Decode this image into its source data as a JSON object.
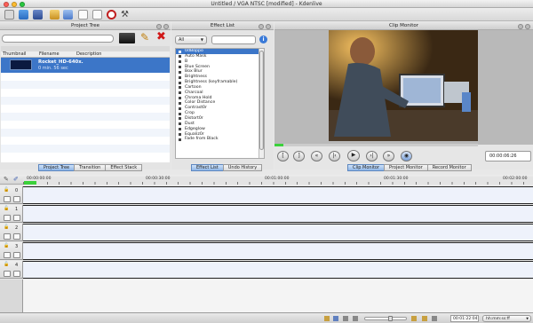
{
  "window": {
    "title": "Untitled / VGA NTSC [modified] - Kdenlive"
  },
  "project_tree": {
    "header": "Project Tree",
    "columns": [
      "Thumbnail",
      "Filename",
      "Description"
    ],
    "clip": {
      "name": "Rocket_HD-640x.",
      "duration": "0 min. 56 sec"
    },
    "tabs": [
      "Project Tree",
      "Transition",
      "Effect Stack"
    ]
  },
  "effect_list": {
    "header": "Effect List",
    "filter": "All",
    "items": [
      "0dBoppo",
      "Auto Mask",
      "B",
      "Blue Screen",
      "Box Blur",
      "Brightness",
      "Brightness (keyframable)",
      "Cartoon",
      "Charcoal",
      "Chroma Hold",
      "Color Distance",
      "Contrast0r",
      "Crop",
      "Distort0r",
      "Dust",
      "Edgeglow",
      "Equaliz0r",
      "Fade from Black"
    ],
    "tabs": [
      "Effect List",
      "Undo History"
    ]
  },
  "clip_monitor": {
    "header": "Clip Monitor",
    "timecode": "00:00:06:26",
    "tabs": [
      "Clip Monitor",
      "Project Monitor",
      "Record Monitor"
    ]
  },
  "timeline": {
    "ruler": [
      "00:00:00:00",
      "00:00:30:00",
      "00:01:00:00",
      "00:01:30:00",
      "00:02:00:00"
    ],
    "tracks": [
      "0",
      "1",
      "2",
      "3",
      "4"
    ]
  },
  "status": {
    "timecode": "00:01:22:04",
    "format": "hh:mm:ss:ff"
  }
}
